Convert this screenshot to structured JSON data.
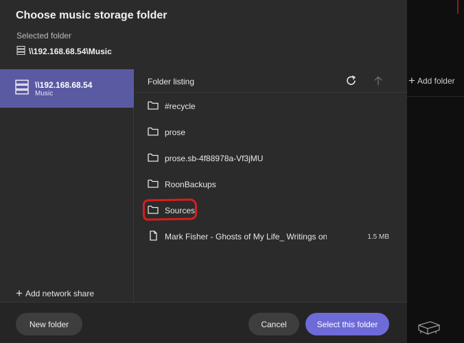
{
  "dialog": {
    "title": "Choose music storage folder",
    "selected_label": "Selected folder",
    "selected_path": "\\\\192.168.68.54\\Music"
  },
  "sidebar": {
    "shares": [
      {
        "name": "\\\\192.168.68.54",
        "subtitle": "Music",
        "icon": "server-icon",
        "selected": true
      }
    ],
    "add_share_label": "Add network share"
  },
  "listing": {
    "title": "Folder listing",
    "refresh_icon": "refresh-icon",
    "up_icon": "arrow-up-icon",
    "items": [
      {
        "name": "#recycle",
        "type": "folder",
        "icon": "folder-icon",
        "size": ""
      },
      {
        "name": "prose",
        "type": "folder",
        "icon": "folder-icon",
        "size": ""
      },
      {
        "name": "prose.sb-4f88978a-Vf3jMU",
        "type": "folder",
        "icon": "folder-icon",
        "size": ""
      },
      {
        "name": "RoonBackups",
        "type": "folder",
        "icon": "folder-icon",
        "size": ""
      },
      {
        "name": "Sources",
        "type": "folder",
        "icon": "folder-icon",
        "size": "",
        "annotated": true
      },
      {
        "name": "Mark Fisher - Ghosts of My Life_ Writings on",
        "type": "file",
        "icon": "file-icon",
        "size": "1.5 MB"
      }
    ]
  },
  "footer": {
    "new_folder_label": "New folder",
    "cancel_label": "Cancel",
    "select_label": "Select this folder"
  },
  "background": {
    "add_folder_label": "Add folder"
  },
  "colors": {
    "accent": "#6e6ad8",
    "selected_share_bg": "#5a5aa3",
    "annotation": "#d91e1e",
    "dialog_bg": "#2b2b2b"
  }
}
